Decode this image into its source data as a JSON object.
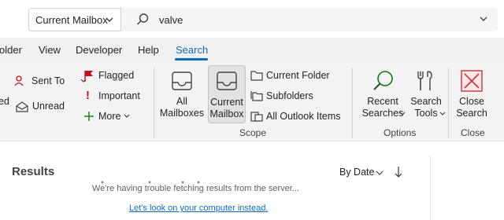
{
  "search": {
    "scope_label": "Current Mailbox",
    "query": "valve"
  },
  "tabs": [
    {
      "label": "older"
    },
    {
      "label": "View"
    },
    {
      "label": "Developer"
    },
    {
      "label": "Help"
    },
    {
      "label": "Search",
      "active": true
    }
  ],
  "ribbon": {
    "refine": {
      "cutoff_label": "ed",
      "sent_to": "Sent To",
      "unread": "Unread",
      "flagged": "Flagged",
      "important": "Important",
      "more": "More"
    },
    "scope": {
      "all_mailboxes": "All\nMailboxes",
      "current_mailbox": "Current\nMailbox",
      "current_folder": "Current Folder",
      "subfolders": "Subfolders",
      "all_outlook_items": "All Outlook Items",
      "group_label": "Scope"
    },
    "options": {
      "recent_searches": "Recent\nSearches",
      "search_tools": "Search\nTools",
      "group_label": "Options"
    },
    "close": {
      "close_search": "Close\nSearch",
      "group_label": "Close"
    }
  },
  "results": {
    "title": "Results",
    "sort_label": "By Date",
    "message": "We're having trouble fetching results from the server...",
    "link": "Let's look on your computer instead."
  },
  "colors": {
    "accent": "#0f6cbd",
    "flag_red": "#c50f1f",
    "green": "#107c10",
    "close_red": "#d13438"
  }
}
